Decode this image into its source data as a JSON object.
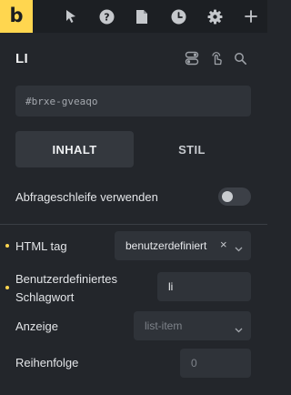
{
  "toolbar": {
    "logo_letter": "b",
    "icons": [
      "cursor-icon",
      "help-icon",
      "page-icon",
      "history-icon",
      "settings-icon",
      "plus-icon"
    ]
  },
  "element": {
    "title": "LI",
    "id_value": "#brxe-gveaqo"
  },
  "tabs": [
    {
      "label": "INHALT",
      "active": true
    },
    {
      "label": "STIL",
      "active": false
    }
  ],
  "loop": {
    "label": "Abfrageschleife verwenden",
    "enabled": false
  },
  "fields": {
    "html_tag": {
      "label": "HTML tag",
      "value": "benutzerdefiniert",
      "clear_glyph": "×"
    },
    "custom_tag": {
      "label_line1": "Benutzerdefiniertes",
      "label_line2": "Schlagwort",
      "value": "li"
    },
    "display": {
      "label": "Anzeige",
      "placeholder": "list-item"
    },
    "order": {
      "label": "Reihenfolge",
      "placeholder": "0"
    }
  },
  "colors": {
    "accent": "#ffd64f",
    "panel": "#23262b",
    "toolbar": "#1c1f23",
    "field": "#2f3339"
  }
}
